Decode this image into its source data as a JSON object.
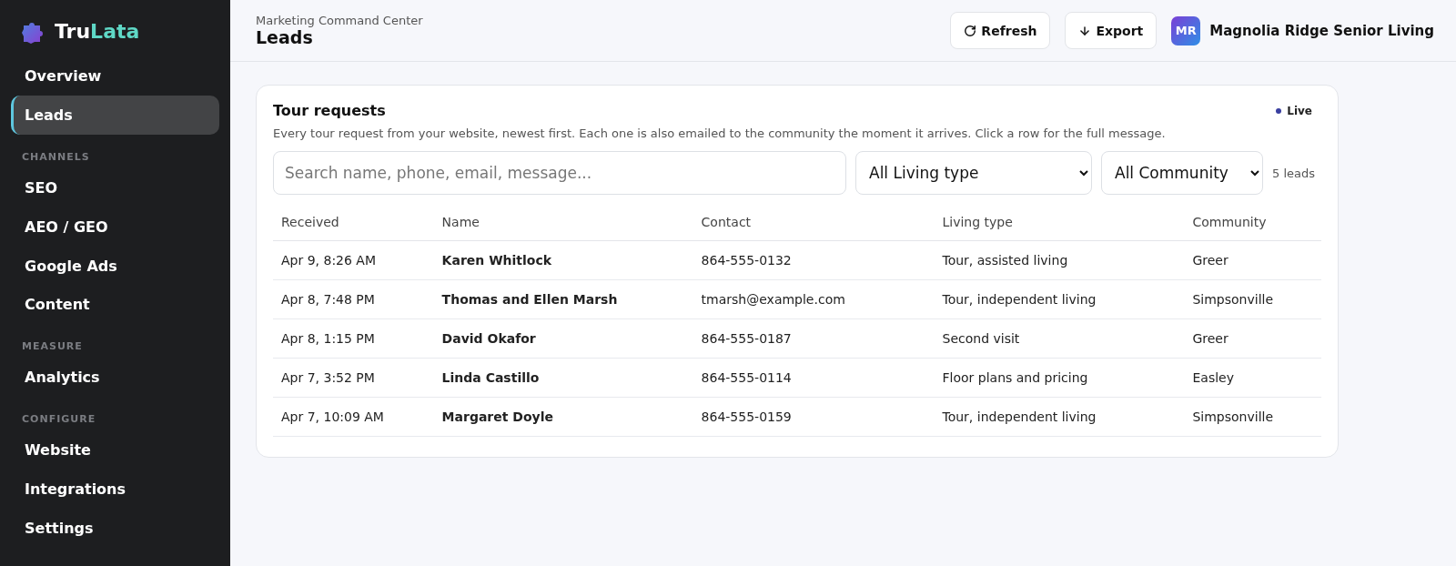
{
  "brand": {
    "part_1": "Tru",
    "part_2": "Lata"
  },
  "sidebar": {
    "sections": [
      {
        "items": [
          {
            "label": "Overview",
            "selected": false
          },
          {
            "label": "Leads",
            "selected": true
          }
        ]
      },
      {
        "heading": "CHANNELS",
        "items": [
          {
            "label": "SEO",
            "selected": false
          },
          {
            "label": "AEO / GEO",
            "selected": false
          },
          {
            "label": "Google Ads",
            "selected": false
          },
          {
            "label": "Content",
            "selected": false
          }
        ]
      },
      {
        "heading": "MEASURE",
        "items": [
          {
            "label": "Analytics",
            "selected": false
          }
        ]
      },
      {
        "heading": "CONFIGURE",
        "items": [
          {
            "label": "Website",
            "selected": false
          },
          {
            "label": "Integrations",
            "selected": false
          },
          {
            "label": "Settings",
            "selected": false
          }
        ]
      }
    ]
  },
  "header": {
    "subtitle": "Marketing Command Center",
    "title": "Leads",
    "buttons": [
      {
        "kind": "refresh",
        "label": "Refresh"
      },
      {
        "kind": "export",
        "label": "Export"
      }
    ],
    "account": {
      "initials": "MR",
      "name": "Magnolia Ridge Senior Living"
    }
  },
  "card": {
    "title": "Tour requests",
    "live": "Live",
    "description": "Every tour request from your website, newest first. Each one is also emailed to the community the moment it arrives. Click a row for the full message.",
    "search": {
      "placeholder": "Search name, phone, email, message..."
    },
    "filters": [
      "All Living type",
      "All Community"
    ],
    "count": "5 leads",
    "table": {
      "columns": [
        "Received",
        "Name",
        "Contact",
        "Living type",
        "Community"
      ],
      "rows": [
        [
          "Apr 9, 8:26 AM",
          "Karen Whitlock",
          "864-555-0132",
          "Tour, assisted living",
          "Greer"
        ],
        [
          "Apr 8, 7:48 PM",
          "Thomas and Ellen Marsh",
          "tmarsh@example.com",
          "Tour, independent living",
          "Simpsonville"
        ],
        [
          "Apr 8, 1:15 PM",
          "David Okafor",
          "864-555-0187",
          "Second visit",
          "Greer"
        ],
        [
          "Apr 7, 3:52 PM",
          "Linda Castillo",
          "864-555-0114",
          "Floor plans and pricing",
          "Easley"
        ],
        [
          "Apr 7, 10:09 AM",
          "Margaret Doyle",
          "864-555-0159",
          "Tour, independent living",
          "Simpsonville"
        ]
      ]
    }
  }
}
